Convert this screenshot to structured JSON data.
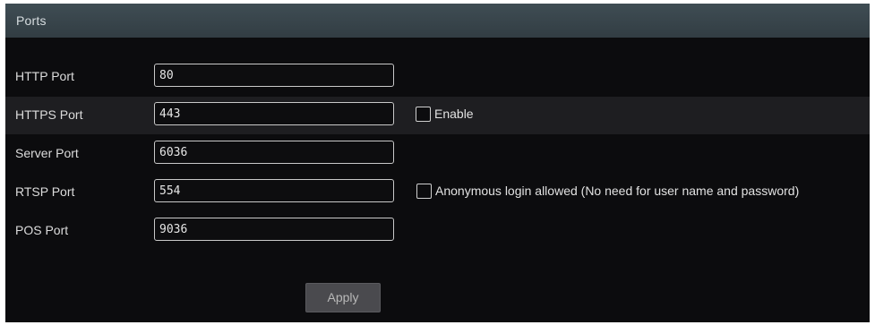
{
  "panel": {
    "title": "Ports"
  },
  "ports": [
    {
      "label": "HTTP Port",
      "value": "80"
    },
    {
      "label": "HTTPS Port",
      "value": "443",
      "checkbox": {
        "label": "Enable",
        "checked": false
      }
    },
    {
      "label": "Server Port",
      "value": "6036"
    },
    {
      "label": "RTSP Port",
      "value": "554",
      "checkbox": {
        "label": "Anonymous login allowed (No need for user name and password)",
        "checked": false
      }
    },
    {
      "label": "POS Port",
      "value": "9036"
    }
  ],
  "actions": {
    "apply_label": "Apply"
  },
  "colors": {
    "background": "#0c0c0e",
    "header": "#3a474e",
    "highlight_row": "#1e1e21",
    "button": "#4a4a4e"
  }
}
